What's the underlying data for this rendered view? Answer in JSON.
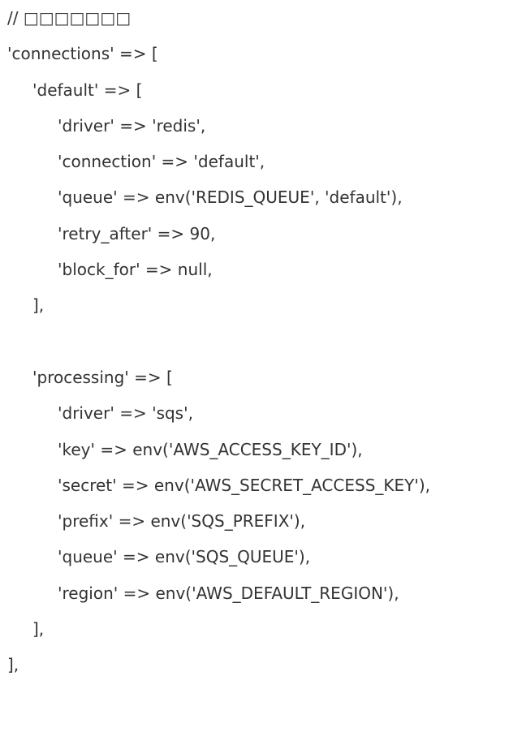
{
  "code": {
    "lines": [
      {
        "text": "// □□□□□□□",
        "indent": 0
      },
      {
        "text": "'connections' => [",
        "indent": 0
      },
      {
        "text": "'default' => [",
        "indent": 1
      },
      {
        "text": "'driver' => 'redis',",
        "indent": 2
      },
      {
        "text": "'connection' => 'default',",
        "indent": 2
      },
      {
        "text": "'queue' => env('REDIS_QUEUE', 'default'),",
        "indent": 2
      },
      {
        "text": "'retry_after' => 90,",
        "indent": 2
      },
      {
        "text": "'block_for' => null,",
        "indent": 2
      },
      {
        "text": "],",
        "indent": 1
      },
      {
        "text": "",
        "indent": 0
      },
      {
        "text": "'processing' => [",
        "indent": 1
      },
      {
        "text": "'driver' => 'sqs',",
        "indent": 2
      },
      {
        "text": "'key' => env('AWS_ACCESS_KEY_ID'),",
        "indent": 2
      },
      {
        "text": "'secret' => env('AWS_SECRET_ACCESS_KEY'),",
        "indent": 2
      },
      {
        "text": "'prefix' => env('SQS_PREFIX'),",
        "indent": 2
      },
      {
        "text": "'queue' => env('SQS_QUEUE'),",
        "indent": 2
      },
      {
        "text": "'region' => env('AWS_DEFAULT_REGION'),",
        "indent": 2
      },
      {
        "text": "],",
        "indent": 1
      },
      {
        "text": "],",
        "indent": 0
      }
    ]
  }
}
